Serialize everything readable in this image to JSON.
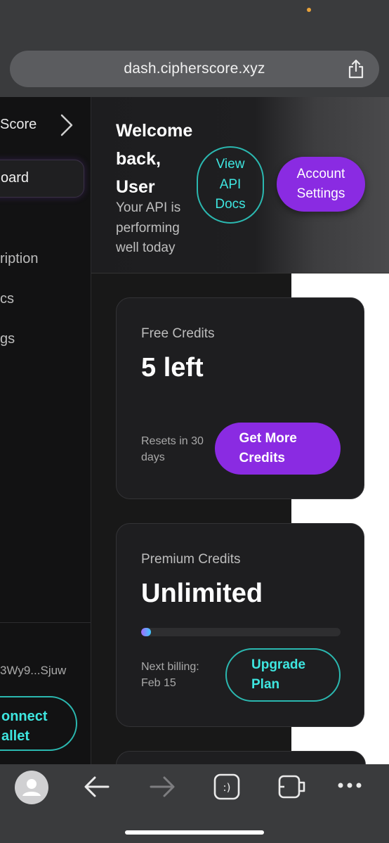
{
  "browser": {
    "url": "dash.cipherscore.xyz"
  },
  "sidebar": {
    "brand": "Score",
    "items": [
      {
        "label": "oard"
      },
      {
        "label": "ription"
      },
      {
        "label": "cs"
      },
      {
        "label": "gs"
      }
    ],
    "wallet_address": "3Wy9...Sjuw",
    "connect_label": "onnect\nallet"
  },
  "header": {
    "welcome": "Welcome back, User",
    "subtitle": "Your API is performing well today",
    "view_docs_label": "View API Docs",
    "account_settings_label": "Account Settings"
  },
  "cards": {
    "free": {
      "label": "Free Credits",
      "value": "5 left",
      "note": "Resets in 30 days",
      "button": "Get More Credits"
    },
    "premium": {
      "label": "Premium Credits",
      "value": "Unlimited",
      "progress": 0.05,
      "note": "Next billing: Feb 15",
      "button": "Upgrade Plan"
    }
  },
  "colors": {
    "accent_purple": "#8a2be2",
    "accent_cyan": "#3ee6e0"
  },
  "toolbar": {
    "icons": [
      "avatar-icon",
      "back-arrow-icon",
      "forward-arrow-icon",
      "reader-icon",
      "tabs-icon",
      "more-icon"
    ]
  }
}
